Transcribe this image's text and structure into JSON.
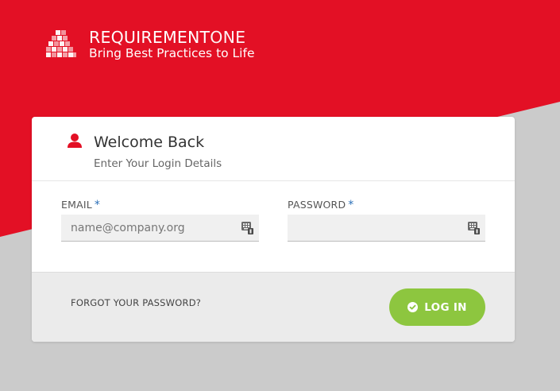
{
  "theme": {
    "brand_red": "#e31025",
    "background_gray": "#cbcbcb",
    "accent_green": "#8dc63f",
    "required_blue": "#2a6fb7"
  },
  "brand": {
    "name_bold": "REQUIREMENT",
    "name_light": "ONE",
    "tagline": "Bring Best Practices to Life",
    "logo_icon": "stacked-pyramid-logo"
  },
  "login": {
    "title": "Welcome Back",
    "subtitle": "Enter Your Login Details",
    "header_icon": "user-icon",
    "email": {
      "label": "EMAIL",
      "required_marker": "*",
      "value": "",
      "placeholder": "name@company.org",
      "icon": "keyboard-icon"
    },
    "password": {
      "label": "PASSWORD",
      "required_marker": "*",
      "value": "",
      "placeholder": "",
      "icon": "keyboard-icon"
    },
    "forgot_link": "FORGOT YOUR PASSWORD?",
    "login_button": "LOG IN",
    "login_button_icon": "check-circle-icon"
  }
}
